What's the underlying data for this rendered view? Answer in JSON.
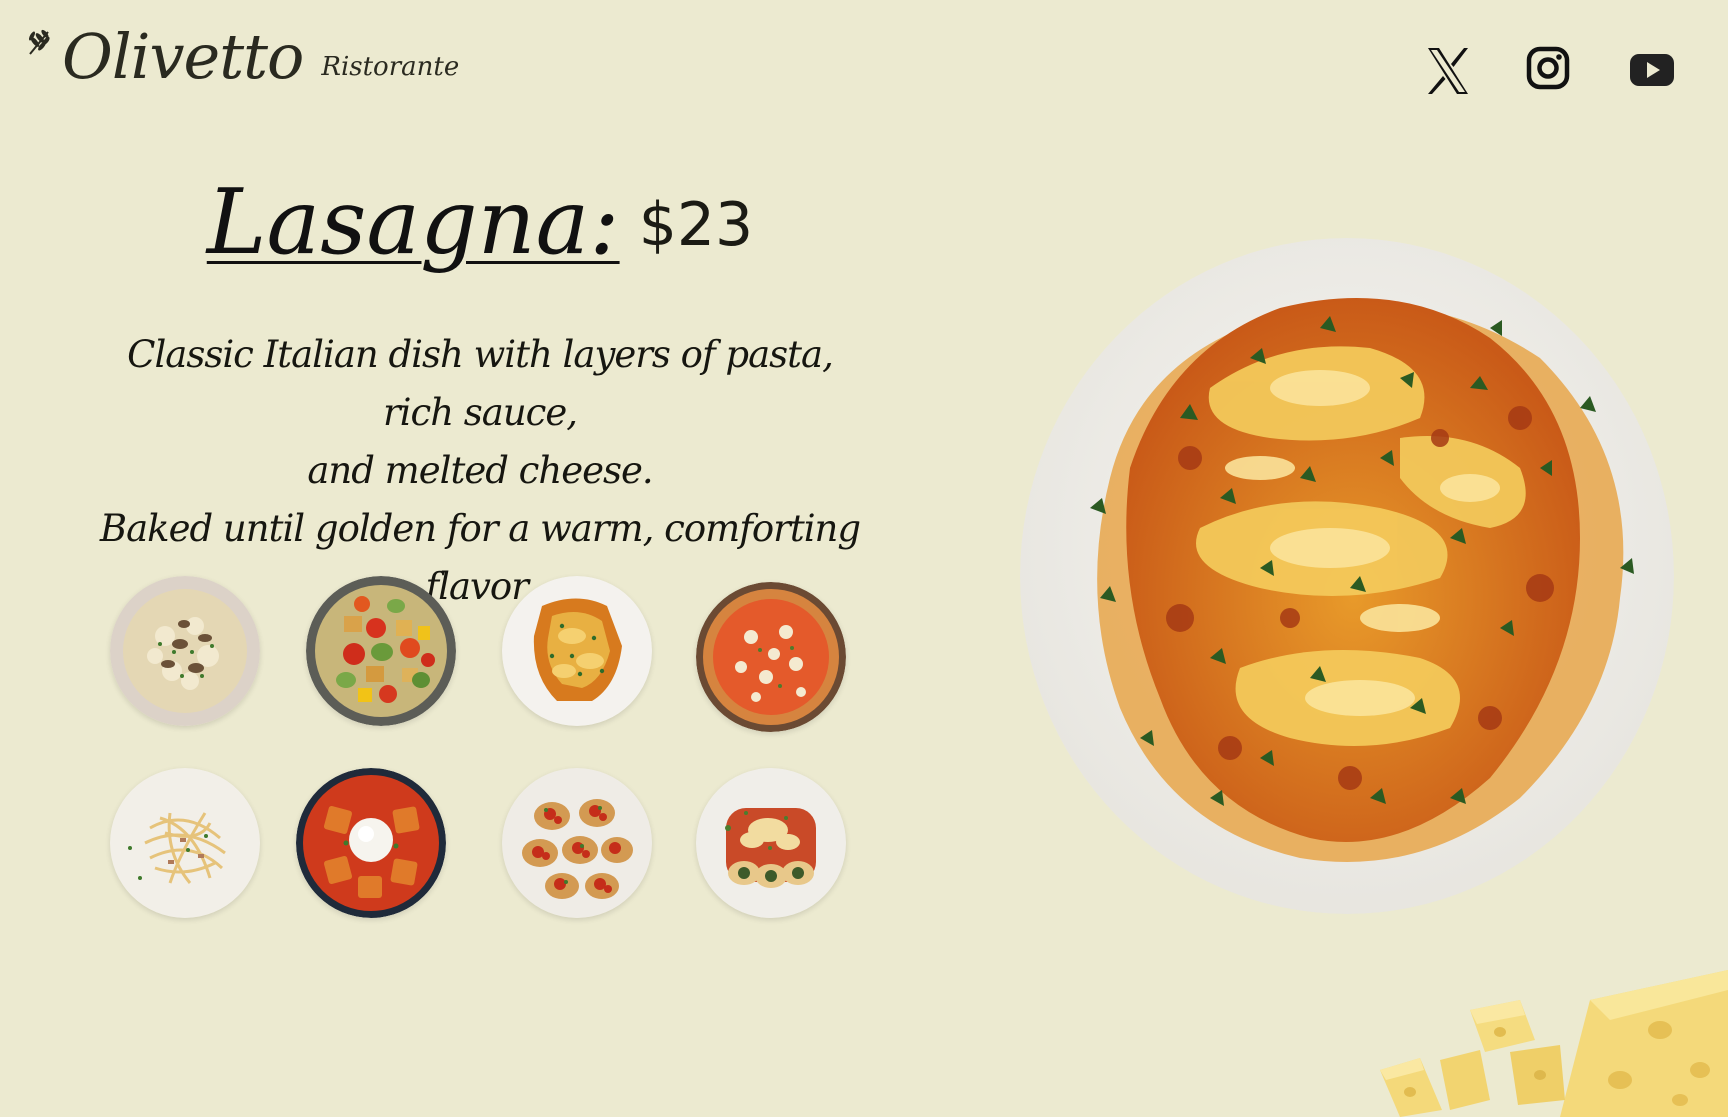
{
  "brand": {
    "name": "Olivetto",
    "tagline": "Ristorante"
  },
  "social": {
    "icons": [
      "x-icon",
      "instagram-icon",
      "youtube-icon"
    ]
  },
  "dish": {
    "name": "Lasagna:",
    "price": "$23",
    "description_lines": [
      "Classic Italian dish with layers of pasta, rich sauce,",
      "and melted cheese.",
      "Baked until golden for a warm, comforting flavor."
    ]
  },
  "colors": {
    "background": "#ecead0",
    "text": "#1d1d15"
  }
}
